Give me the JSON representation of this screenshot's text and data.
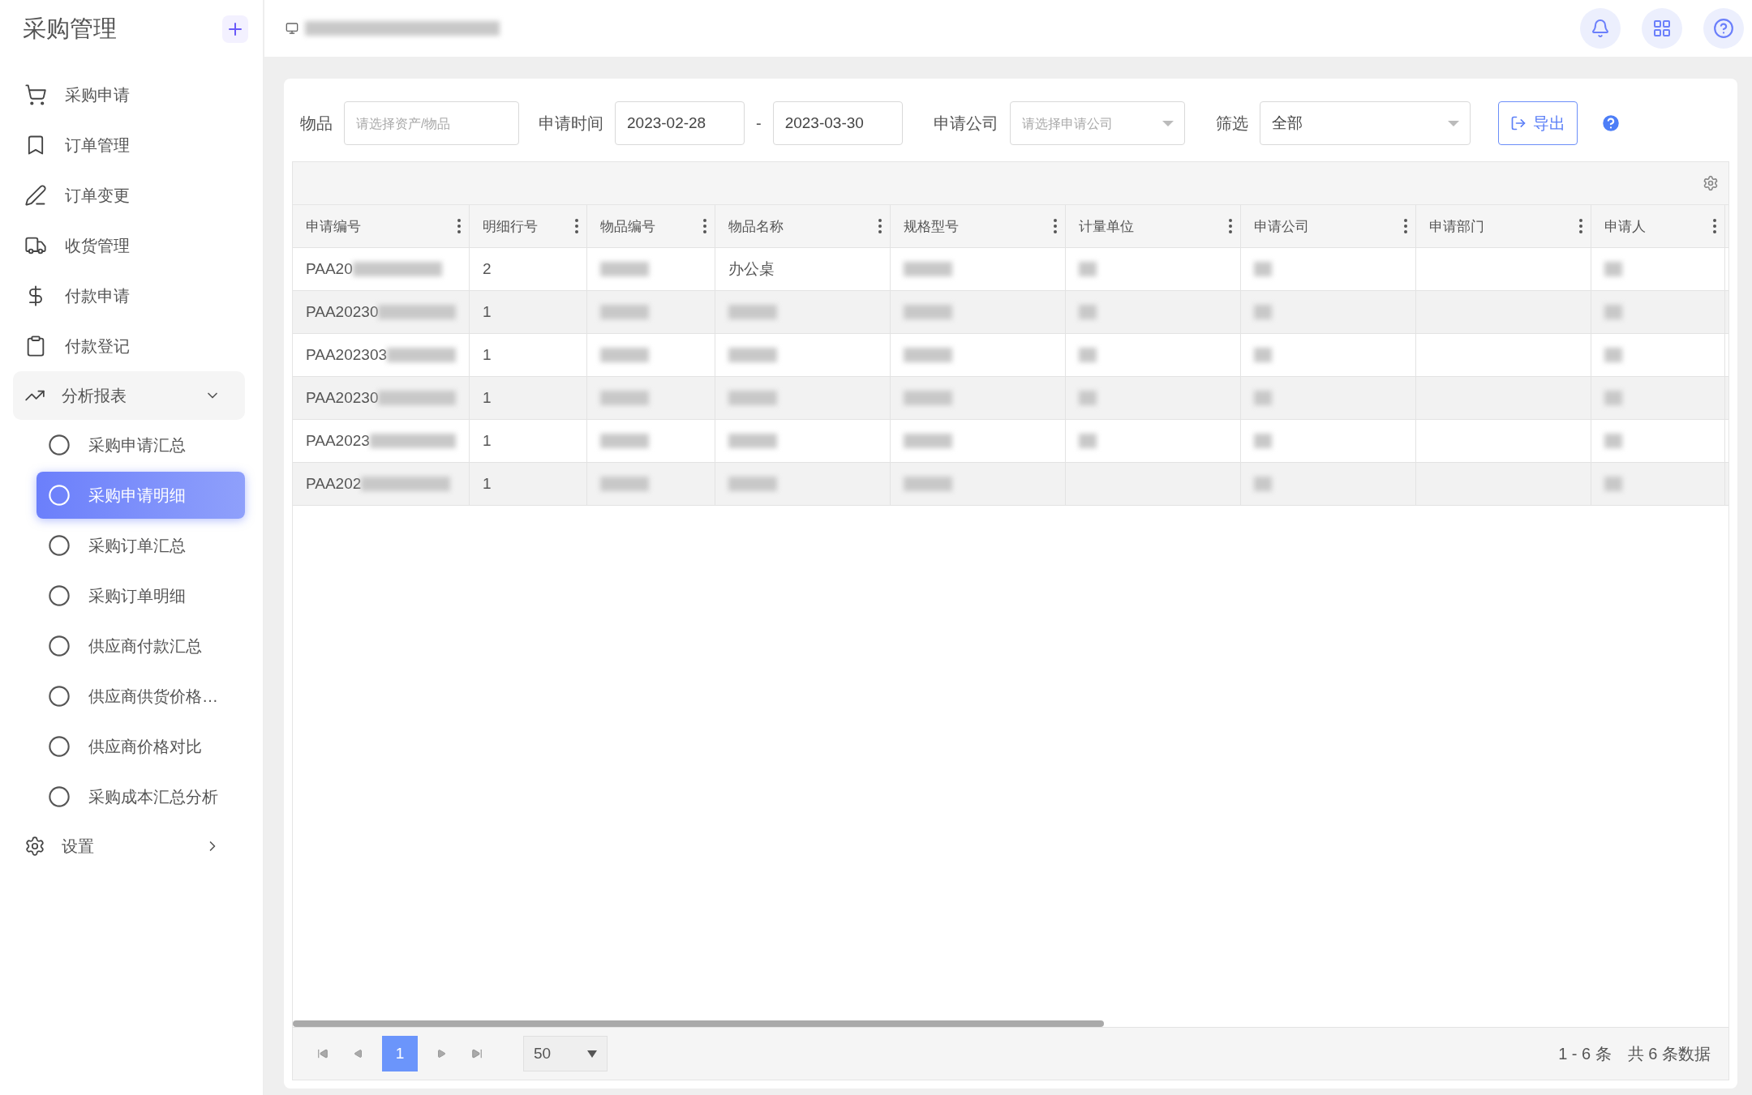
{
  "sidebar": {
    "title": "采购管理",
    "items": [
      {
        "kind": "item",
        "label": "采购申请"
      },
      {
        "kind": "item",
        "label": "订单管理"
      },
      {
        "kind": "item",
        "label": "订单变更"
      },
      {
        "kind": "item",
        "label": "收货管理"
      },
      {
        "kind": "item",
        "label": "付款申请"
      },
      {
        "kind": "item",
        "label": "付款登记"
      },
      {
        "kind": "group",
        "label": "分析报表",
        "expanded": true,
        "children": [
          {
            "label": "采购申请汇总",
            "selected": false
          },
          {
            "label": "采购申请明细",
            "selected": true
          },
          {
            "label": "采购订单汇总",
            "selected": false
          },
          {
            "label": "采购订单明细",
            "selected": false
          },
          {
            "label": "供应商付款汇总",
            "selected": false
          },
          {
            "label": "供应商供货价格…",
            "selected": false
          },
          {
            "label": "供应商价格对比",
            "selected": false
          },
          {
            "label": "采购成本汇总分析",
            "selected": false
          }
        ]
      },
      {
        "kind": "group",
        "label": "设置",
        "expanded": false
      }
    ]
  },
  "filters": [
    {
      "kind": "text",
      "label": "物品",
      "placeholder": "请选择资产/物品"
    },
    {
      "kind": "range",
      "label": "申请时间",
      "from": "2023-02-28",
      "separator": "-",
      "to": "2023-03-30"
    },
    {
      "kind": "select",
      "label": "申请公司",
      "placeholder": "请选择申请公司"
    },
    {
      "kind": "select",
      "label": "筛选",
      "value": "全部"
    }
  ],
  "export_button": "导出",
  "table": {
    "columns": [
      "申请编号",
      "明细行号",
      "物品编号",
      "物品名称",
      "规格型号",
      "计量单位",
      "申请公司",
      "申请部门",
      "申请人"
    ],
    "rows": [
      [
        {
          "text": "PAA20",
          "blurred": true
        },
        {
          "text": "2"
        },
        {
          "blurred": true
        },
        {
          "text": "办公桌"
        },
        {
          "blurred": true
        },
        {
          "blurred": true
        },
        {
          "blurred": true
        },
        {},
        {
          "blurred": true
        }
      ],
      [
        {
          "text": "PAA20230",
          "blurred": true
        },
        {
          "text": "1"
        },
        {
          "blurred": true
        },
        {
          "blurred": true
        },
        {
          "blurred": true
        },
        {
          "blurred": true
        },
        {
          "blurred": true
        },
        {},
        {
          "blurred": true
        }
      ],
      [
        {
          "text": "PAA202303",
          "blurred": true
        },
        {
          "text": "1"
        },
        {
          "blurred": true
        },
        {
          "blurred": true
        },
        {
          "blurred": true
        },
        {
          "blurred": true
        },
        {
          "blurred": true
        },
        {},
        {
          "blurred": true
        }
      ],
      [
        {
          "text": "PAA20230",
          "blurred": true
        },
        {
          "text": "1"
        },
        {
          "blurred": true
        },
        {
          "blurred": true
        },
        {
          "blurred": true
        },
        {
          "blurred": true
        },
        {
          "blurred": true
        },
        {},
        {
          "blurred": true
        }
      ],
      [
        {
          "text": "PAA2023",
          "blurred": true
        },
        {
          "text": "1"
        },
        {
          "blurred": true
        },
        {
          "blurred": true
        },
        {
          "blurred": true
        },
        {
          "blurred": true
        },
        {
          "blurred": true
        },
        {},
        {
          "blurred": true
        }
      ],
      [
        {
          "text": "PAA202",
          "blurred": true
        },
        {
          "text": "1"
        },
        {
          "blurred": true
        },
        {
          "blurred": true
        },
        {
          "blurred": true
        },
        {},
        {
          "blurred": true
        },
        {},
        {
          "blurred": true
        }
      ]
    ]
  },
  "pagination": {
    "pages": [
      {
        "label": "1",
        "selected": true
      }
    ],
    "page_size": "50",
    "range": "1 - 6 条",
    "total": "共 6 条数据"
  }
}
